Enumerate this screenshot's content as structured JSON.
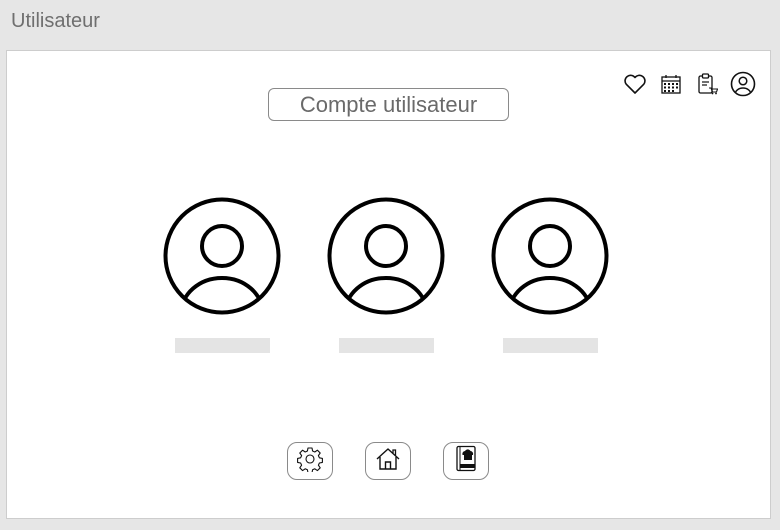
{
  "window": {
    "title": "Utilisateur"
  },
  "header": {
    "title": "Compte utilisateur",
    "icons": [
      "heart-icon",
      "calendar-icon",
      "shopping-list-icon",
      "user-account-icon"
    ]
  },
  "users": [
    {
      "icon": "user-avatar-icon",
      "name": ""
    },
    {
      "icon": "user-avatar-icon",
      "name": ""
    },
    {
      "icon": "user-avatar-icon",
      "name": ""
    }
  ],
  "bottom_nav": {
    "icons": [
      "gear-icon",
      "home-icon",
      "recipe-book-icon"
    ]
  },
  "colors": {
    "background": "#e6e6e6",
    "frame": "#ffffff",
    "placeholder_bar": "#e4e4e4",
    "outline": "#8a8a8a"
  }
}
